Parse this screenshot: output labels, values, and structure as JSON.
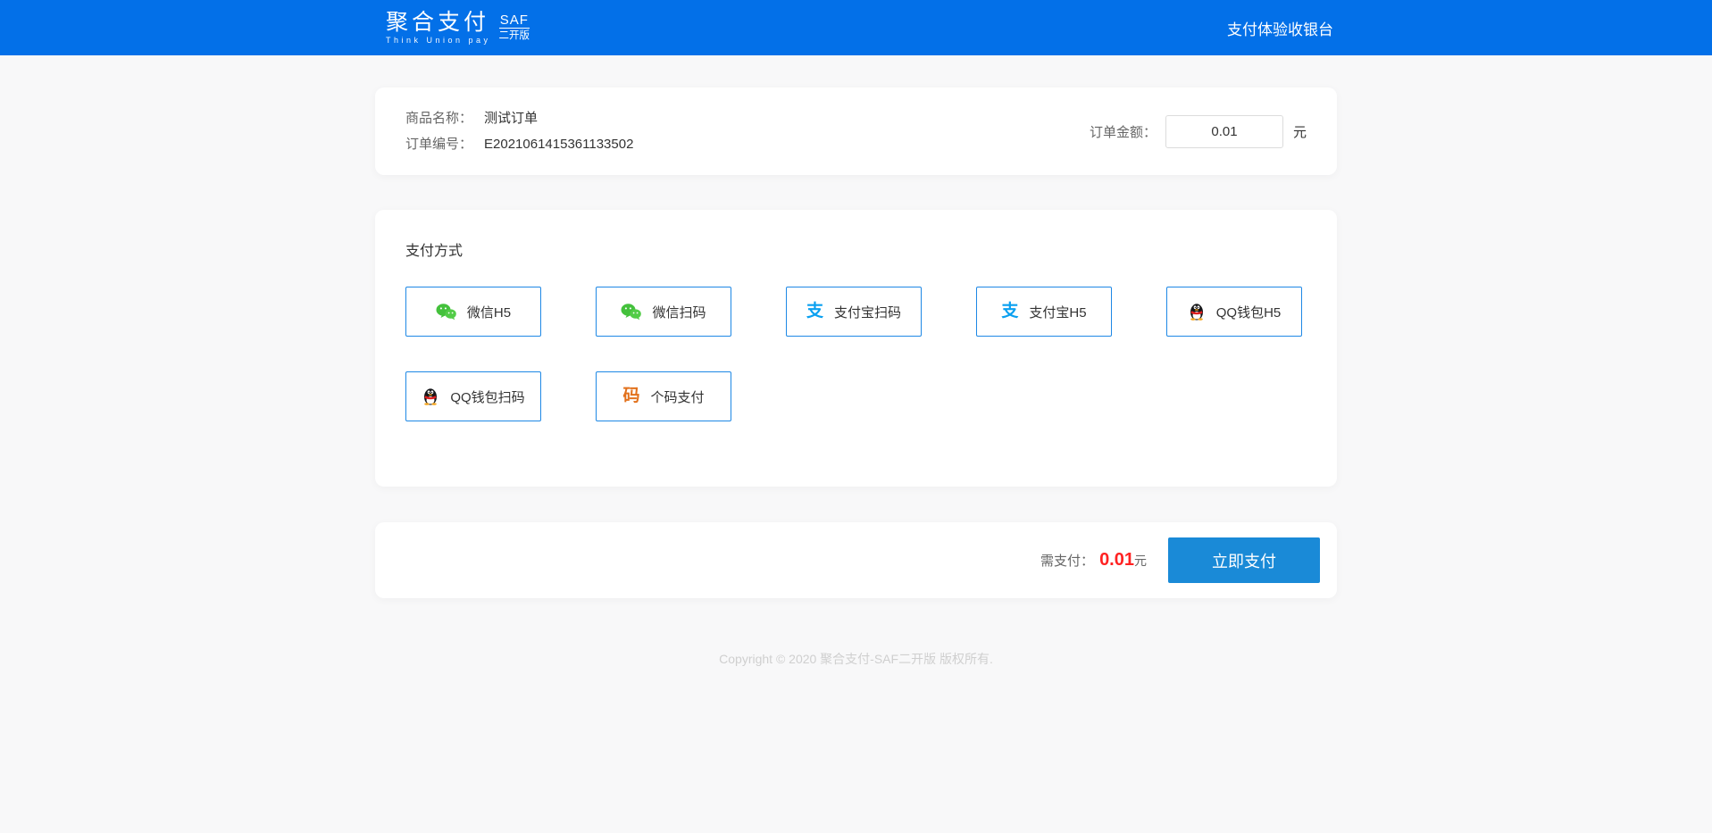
{
  "header": {
    "logo_title": "聚合支付",
    "logo_subtitle": "Think Union pay",
    "badge_top": "SAF",
    "badge_bottom": "二开版",
    "page_title": "支付体验收银台"
  },
  "order": {
    "product_label": "商品名称：",
    "product_value": "测试订单",
    "number_label": "订单编号：",
    "number_value": "E2021061415361133502",
    "amount_label": "订单金额：",
    "amount_value": "0.01",
    "amount_unit": "元"
  },
  "payment": {
    "title": "支付方式",
    "methods": [
      {
        "label": "微信H5",
        "icon": "wechat"
      },
      {
        "label": "微信扫码",
        "icon": "wechat"
      },
      {
        "label": "支付宝扫码",
        "icon": "alipay"
      },
      {
        "label": "支付宝H5",
        "icon": "alipay"
      },
      {
        "label": "QQ钱包H5",
        "icon": "qq"
      },
      {
        "label": "QQ钱包扫码",
        "icon": "qq"
      },
      {
        "label": "个码支付",
        "icon": "code"
      }
    ]
  },
  "paybar": {
    "due_label": "需支付：",
    "due_value": "0.01",
    "due_unit": "元",
    "pay_button_label": "立即支付"
  },
  "footer": {
    "copyright": "Copyright © 2020 聚合支付-SAF二开版 版权所有."
  },
  "colors": {
    "header_blue": "#0370e8",
    "method_border_blue": "#1e88e5",
    "pay_button_blue": "#1a8ad7",
    "price_red": "#ff2222",
    "wechat_green": "#44c13c",
    "alipay_blue": "#0aa0f0",
    "code_orange": "#e2711c",
    "page_background": "#f8f8f9"
  }
}
